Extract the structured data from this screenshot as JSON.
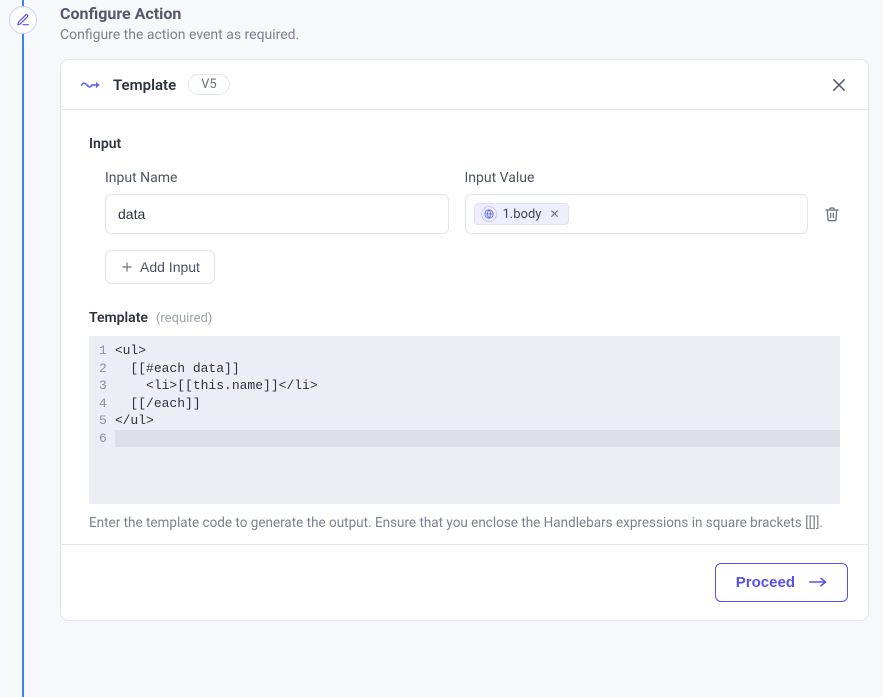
{
  "step": {
    "title": "Configure Action",
    "subtitle": "Configure the action event as required."
  },
  "card": {
    "title": "Template",
    "version_badge": "V5"
  },
  "input_section": {
    "label": "Input",
    "name_label": "Input Name",
    "value_label": "Input Value",
    "name_value": "data",
    "value_chip": "1.body",
    "add_button": "Add Input"
  },
  "template_section": {
    "label": "Template",
    "required_hint": "(required)",
    "code_lines": [
      "<ul>",
      "  [[#each data]]",
      "    <li>[[this.name]]</li>",
      "  [[/each]]",
      "</ul>",
      ""
    ],
    "help_text": "Enter the template code to generate the output. Ensure that you enclose the Handlebars expressions in square brackets [[]]."
  },
  "footer": {
    "proceed": "Proceed"
  }
}
